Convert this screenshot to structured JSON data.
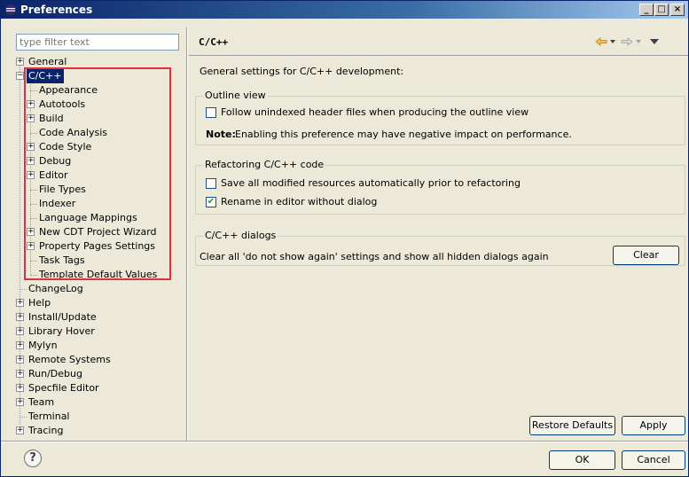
{
  "window": {
    "title": "Preferences"
  },
  "filter": {
    "placeholder": "type filter text"
  },
  "tree": {
    "general": "General",
    "cpp": "C/C++",
    "cpp_children": [
      {
        "label": "Appearance",
        "expandable": false
      },
      {
        "label": "Autotools",
        "expandable": true
      },
      {
        "label": "Build",
        "expandable": true
      },
      {
        "label": "Code Analysis",
        "expandable": false
      },
      {
        "label": "Code Style",
        "expandable": true
      },
      {
        "label": "Debug",
        "expandable": true
      },
      {
        "label": "Editor",
        "expandable": true
      },
      {
        "label": "File Types",
        "expandable": false
      },
      {
        "label": "Indexer",
        "expandable": false
      },
      {
        "label": "Language Mappings",
        "expandable": false
      },
      {
        "label": "New CDT Project Wizard",
        "expandable": true
      },
      {
        "label": "Property Pages Settings",
        "expandable": true
      },
      {
        "label": "Task Tags",
        "expandable": false
      },
      {
        "label": "Template Default Values",
        "expandable": false
      }
    ],
    "top_after": [
      {
        "label": "ChangeLog",
        "expandable": false
      },
      {
        "label": "Help",
        "expandable": true
      },
      {
        "label": "Install/Update",
        "expandable": true
      },
      {
        "label": "Library Hover",
        "expandable": true
      },
      {
        "label": "Mylyn",
        "expandable": true
      },
      {
        "label": "Remote Systems",
        "expandable": true
      },
      {
        "label": "Run/Debug",
        "expandable": true
      },
      {
        "label": "Specfile Editor",
        "expandable": true
      },
      {
        "label": "Team",
        "expandable": true
      },
      {
        "label": "Terminal",
        "expandable": false
      },
      {
        "label": "Tracing",
        "expandable": true
      }
    ]
  },
  "page": {
    "title": "C/C++",
    "description": "General settings for C/C++ development:",
    "outline": {
      "legend": "Outline view",
      "checkbox_label": "Follow unindexed header files when producing the outline view",
      "checked": false,
      "note_bold": "Note:",
      "note_text": "Enabling this preference may have negative impact on performance."
    },
    "refactoring": {
      "legend": "Refactoring C/C++ code",
      "save_label": "Save all modified resources automatically prior to refactoring",
      "save_checked": false,
      "rename_label": "Rename in editor without dialog",
      "rename_checked": true
    },
    "dialogs": {
      "legend": "C/C++ dialogs",
      "text": "Clear all 'do not show again' settings and show all hidden dialogs again",
      "clear_button": "Clear"
    }
  },
  "buttons": {
    "restore_defaults": "Restore Defaults",
    "apply": "Apply",
    "ok": "OK",
    "cancel": "Cancel"
  },
  "check_mark": "✔",
  "help_glyph": "?"
}
